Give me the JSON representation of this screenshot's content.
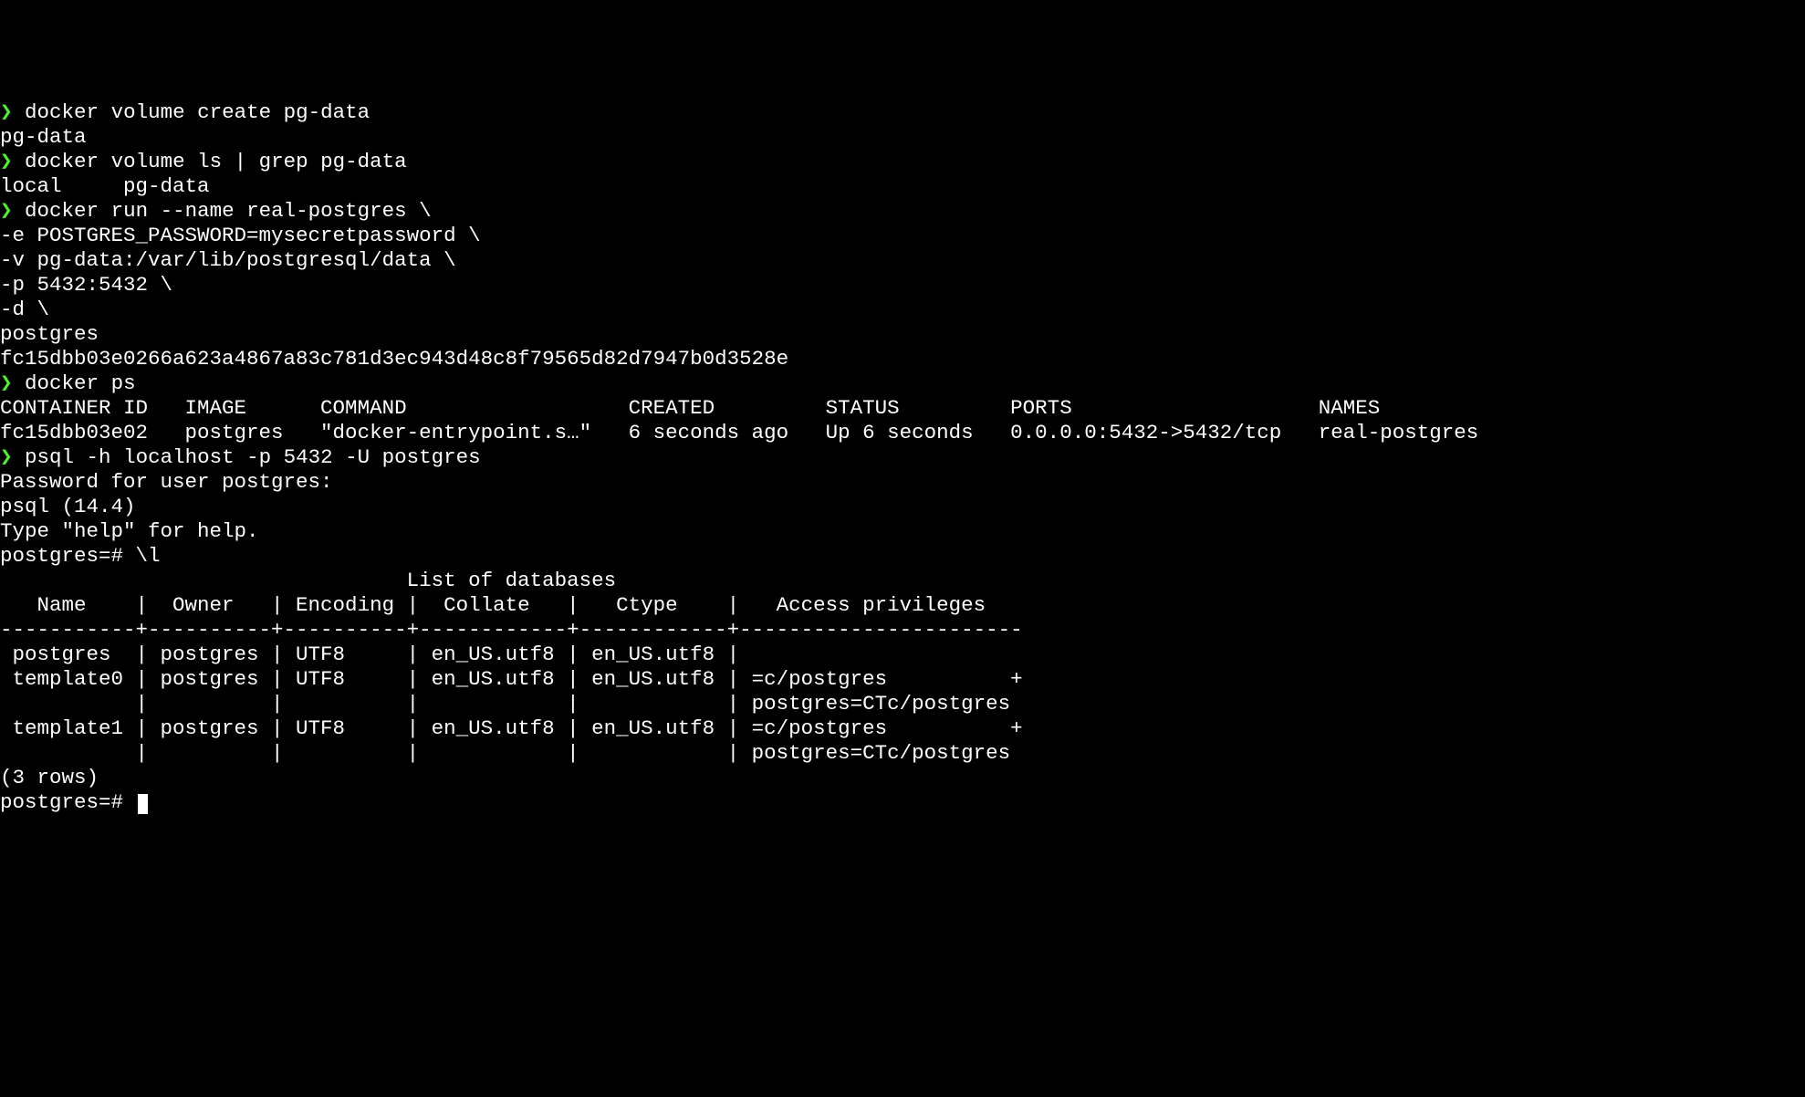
{
  "lines": {
    "l1_prompt": "❯",
    "l1_cmd": " docker volume create pg-data",
    "l2": "pg-data",
    "l3_prompt": "❯",
    "l3_cmd": " docker volume ls | grep pg-data",
    "l4": "local     pg-data",
    "l5_prompt": "❯",
    "l5_cmd": " docker run --name real-postgres \\",
    "l6": "-e POSTGRES_PASSWORD=mysecretpassword \\",
    "l7": "-v pg-data:/var/lib/postgresql/data \\",
    "l8": "-p 5432:5432 \\",
    "l9": "-d \\",
    "l10": "postgres",
    "l11": "fc15dbb03e0266a623a4867a83c781d3ec943d48c8f79565d82d7947b0d3528e",
    "l12_prompt": "❯",
    "l12_cmd": " docker ps",
    "l13": "CONTAINER ID   IMAGE      COMMAND                  CREATED         STATUS         PORTS                    NAMES",
    "l14": "fc15dbb03e02   postgres   \"docker-entrypoint.s…\"   6 seconds ago   Up 6 seconds   0.0.0.0:5432->5432/tcp   real-postgres",
    "l15_prompt": "❯",
    "l15_cmd": " psql -h localhost -p 5432 -U postgres",
    "l16": "Password for user postgres:",
    "l17": "psql (14.4)",
    "l18": "Type \"help\" for help.",
    "l19": "",
    "l20": "postgres=# \\l",
    "l21": "                                 List of databases",
    "l22": "   Name    |  Owner   | Encoding |  Collate   |   Ctype    |   Access privileges   ",
    "l23": "-----------+----------+----------+------------+------------+-----------------------",
    "l24": " postgres  | postgres | UTF8     | en_US.utf8 | en_US.utf8 | ",
    "l25": " template0 | postgres | UTF8     | en_US.utf8 | en_US.utf8 | =c/postgres          +",
    "l26": "           |          |          |            |            | postgres=CTc/postgres",
    "l27": " template1 | postgres | UTF8     | en_US.utf8 | en_US.utf8 | =c/postgres          +",
    "l28": "           |          |          |            |            | postgres=CTc/postgres",
    "l29": "(3 rows)",
    "l30": "",
    "l31": "postgres=# "
  }
}
